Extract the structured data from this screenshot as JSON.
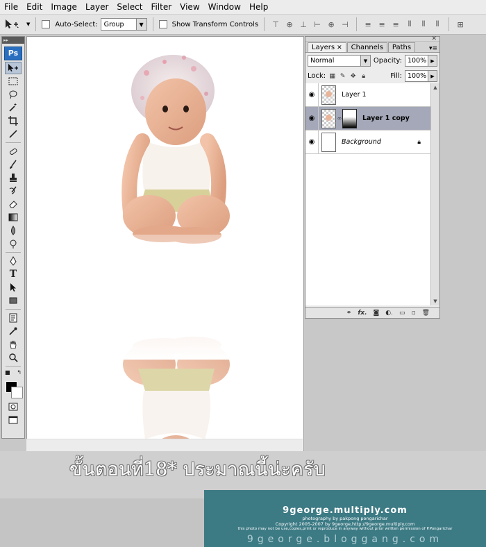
{
  "menu": [
    "File",
    "Edit",
    "Image",
    "Layer",
    "Select",
    "Filter",
    "View",
    "Window",
    "Help"
  ],
  "options": {
    "auto_select_label": "Auto-Select:",
    "auto_select_value": "Group",
    "show_transform_label": "Show Transform Controls"
  },
  "toolbox": {
    "logo": "Ps",
    "tools": [
      "move-tool",
      "marquee-tool",
      "lasso-tool",
      "magic-wand-tool",
      "crop-tool",
      "eyedropper-tool",
      "healing-brush-tool",
      "brush-tool",
      "clone-stamp-tool",
      "history-brush-tool",
      "eraser-tool",
      "gradient-tool",
      "blur-tool",
      "dodge-tool",
      "pen-tool",
      "type-tool",
      "path-selection-tool",
      "shape-tool",
      "notes-tool",
      "eyedropper2-tool",
      "hand-tool",
      "zoom-tool"
    ],
    "foreground_color": "#000000",
    "background_color": "#ffffff"
  },
  "layers_panel": {
    "tabs": [
      {
        "label": "Layers",
        "active": true
      },
      {
        "label": "Channels",
        "active": false
      },
      {
        "label": "Paths",
        "active": false
      }
    ],
    "blend_mode": "Normal",
    "opacity_label": "Opacity:",
    "opacity": "100%",
    "lock_label": "Lock:",
    "fill_label": "Fill:",
    "fill": "100%",
    "layers": [
      {
        "name": "Layer 1",
        "selected": false,
        "has_mask": false,
        "locked": false,
        "italic": false
      },
      {
        "name": "Layer 1 copy",
        "selected": true,
        "has_mask": true,
        "locked": false,
        "italic": false
      },
      {
        "name": "Background",
        "selected": false,
        "has_mask": false,
        "locked": true,
        "italic": true
      }
    ]
  },
  "caption": "ขั้นตอนที่18* ประมาณนี้น่ะครับ",
  "watermark": {
    "site": "9george.multiply.com",
    "credit": "photography by pakpong pongarichar",
    "copyright": "Copyright 2005-2007 by 9george,http://9george.multiply.com",
    "notice": "this photo may not be use,copies,print or reproduce in anyway without prior written permission of P.Pongarichar",
    "blog": "9george.bloggang.com"
  }
}
